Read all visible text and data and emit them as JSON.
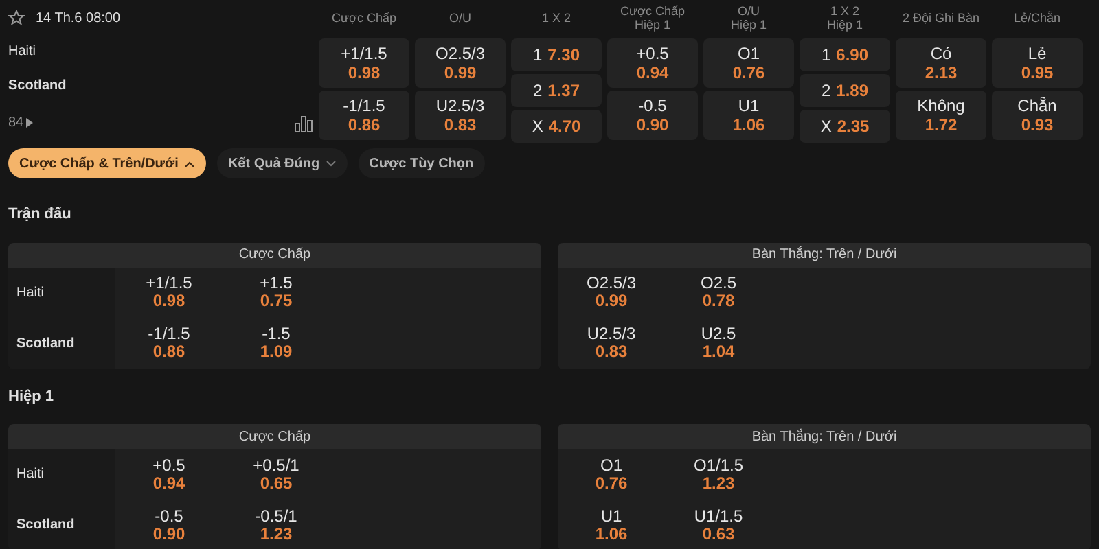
{
  "match": {
    "time": "14 Th.6 08:00",
    "favorite": false,
    "teams": [
      {
        "name": "Haiti",
        "bold": false
      },
      {
        "name": "Scotland",
        "bold": true
      }
    ],
    "more": "84"
  },
  "markets": [
    {
      "kind": "pair",
      "header": [
        "Cược Chấp"
      ],
      "cells": [
        {
          "line": "+1/1.5",
          "odds": "0.98"
        },
        {
          "line": "-1/1.5",
          "odds": "0.86"
        }
      ]
    },
    {
      "kind": "pair",
      "header": [
        "O/U"
      ],
      "cells": [
        {
          "line": "O2.5/3",
          "odds": "0.99"
        },
        {
          "line": "U2.5/3",
          "odds": "0.83"
        }
      ]
    },
    {
      "kind": "triple",
      "header": [
        "1 X 2"
      ],
      "cells": [
        {
          "line": "1",
          "odds": "7.30"
        },
        {
          "line": "2",
          "odds": "1.37"
        },
        {
          "line": "X",
          "odds": "4.70"
        }
      ]
    },
    {
      "kind": "pair",
      "header": [
        "Cược Chấp",
        "Hiệp 1"
      ],
      "cells": [
        {
          "line": "+0.5",
          "odds": "0.94"
        },
        {
          "line": "-0.5",
          "odds": "0.90"
        }
      ]
    },
    {
      "kind": "pair",
      "header": [
        "O/U",
        "Hiệp 1"
      ],
      "cells": [
        {
          "line": "O1",
          "odds": "0.76"
        },
        {
          "line": "U1",
          "odds": "1.06"
        }
      ]
    },
    {
      "kind": "triple",
      "header": [
        "1 X 2",
        "Hiệp 1"
      ],
      "cells": [
        {
          "line": "1",
          "odds": "6.90"
        },
        {
          "line": "2",
          "odds": "1.89"
        },
        {
          "line": "X",
          "odds": "2.35"
        }
      ]
    },
    {
      "kind": "pair",
      "header": [
        "2 Đội Ghi Bàn"
      ],
      "cells": [
        {
          "line": "Có",
          "odds": "2.13"
        },
        {
          "line": "Không",
          "odds": "1.72"
        }
      ]
    },
    {
      "kind": "pair",
      "header": [
        "Lẻ/Chẵn"
      ],
      "cells": [
        {
          "line": "Lẻ",
          "odds": "0.95"
        },
        {
          "line": "Chẵn",
          "odds": "0.93"
        }
      ]
    }
  ],
  "tabs": [
    {
      "label": "Cược Chấp & Trên/Dưới",
      "selected": true,
      "expanded": true
    },
    {
      "label": "Kết Quả Đúng",
      "selected": false,
      "expanded": false
    },
    {
      "label": "Cược Tùy Chọn",
      "selected": false
    }
  ],
  "sections": [
    {
      "title": "Trận đấu",
      "tables": [
        {
          "title": "Cược Chấp",
          "rows": [
            {
              "team": "Haiti",
              "bold": false,
              "cells": [
                {
                  "line": "+1/1.5",
                  "odds": "0.98"
                },
                {
                  "line": "+1.5",
                  "odds": "0.75"
                }
              ]
            },
            {
              "team": "Scotland",
              "bold": true,
              "cells": [
                {
                  "line": "-1/1.5",
                  "odds": "0.86"
                },
                {
                  "line": "-1.5",
                  "odds": "1.09"
                }
              ]
            }
          ]
        },
        {
          "title": "Bàn Thắng: Trên / Dưới",
          "rows": [
            {
              "cells": [
                {
                  "line": "O2.5/3",
                  "odds": "0.99"
                },
                {
                  "line": "O2.5",
                  "odds": "0.78"
                }
              ]
            },
            {
              "cells": [
                {
                  "line": "U2.5/3",
                  "odds": "0.83"
                },
                {
                  "line": "U2.5",
                  "odds": "1.04"
                }
              ]
            }
          ]
        }
      ]
    },
    {
      "title": "Hiệp 1",
      "tables": [
        {
          "title": "Cược Chấp",
          "rows": [
            {
              "team": "Haiti",
              "bold": false,
              "cells": [
                {
                  "line": "+0.5",
                  "odds": "0.94"
                },
                {
                  "line": "+0.5/1",
                  "odds": "0.65"
                }
              ]
            },
            {
              "team": "Scotland",
              "bold": true,
              "cells": [
                {
                  "line": "-0.5",
                  "odds": "0.90"
                },
                {
                  "line": "-0.5/1",
                  "odds": "1.23"
                }
              ]
            }
          ]
        },
        {
          "title": "Bàn Thắng: Trên / Dưới",
          "rows": [
            {
              "cells": [
                {
                  "line": "O1",
                  "odds": "0.76"
                },
                {
                  "line": "O1/1.5",
                  "odds": "1.23"
                }
              ]
            },
            {
              "cells": [
                {
                  "line": "U1",
                  "odds": "1.06"
                },
                {
                  "line": "U1/1.5",
                  "odds": "0.63"
                }
              ]
            }
          ]
        }
      ]
    }
  ]
}
